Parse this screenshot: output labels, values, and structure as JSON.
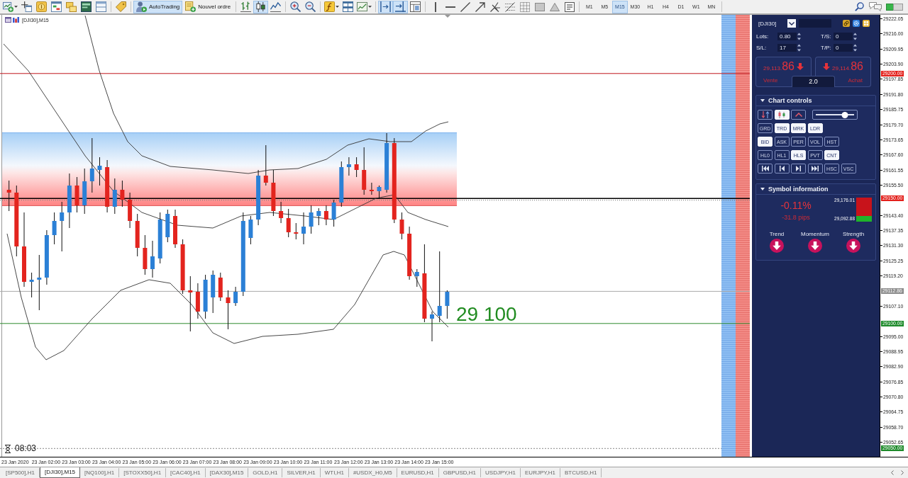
{
  "toolbar": {
    "buttons": [
      {
        "label": "AutoTrading",
        "pressed": true
      },
      {
        "label": "Nouvel ordre",
        "pressed": false
      }
    ],
    "chart_modes": [
      {
        "selected": false
      },
      {
        "selected": true
      },
      {
        "selected": false
      }
    ],
    "scroll_toggles": [
      {
        "on": true
      },
      {
        "on": true
      }
    ],
    "timeframes": [
      {
        "label": "M1",
        "selected": false
      },
      {
        "label": "M5",
        "selected": false
      },
      {
        "label": "M15",
        "selected": true
      },
      {
        "label": "M30",
        "selected": false
      },
      {
        "label": "H1",
        "selected": false
      },
      {
        "label": "H4",
        "selected": false
      },
      {
        "label": "D1",
        "selected": false
      },
      {
        "label": "W1",
        "selected": false
      },
      {
        "label": "MN",
        "selected": false
      }
    ]
  },
  "chart": {
    "title": "[DJI30],M15",
    "level_label": "29 100",
    "timer": "08:03"
  },
  "trade_panel": {
    "symbol": "[DJI30]",
    "fields": [
      {
        "label": "Lots:",
        "value": "0.80"
      },
      {
        "label": "T/S:",
        "value": "0"
      },
      {
        "label": "S/L:",
        "value": "17"
      },
      {
        "label": "T/P:",
        "value": "0"
      }
    ],
    "sell": {
      "price_head": "29,113.",
      "price_tail": "86",
      "label": "Vente"
    },
    "buy": {
      "price_head": "29,114.",
      "price_tail": "86",
      "label": "Achat"
    },
    "spread": "2.0"
  },
  "chart_controls": {
    "title": "Chart controls",
    "expanded": true,
    "tools": [
      {
        "kind": "toggle",
        "on": false
      },
      {
        "kind": "toggle",
        "on": true
      },
      {
        "kind": "toggle",
        "on": false
      },
      {
        "kind": "slider",
        "level": 0.77
      }
    ],
    "rows": [
      [
        {
          "kind": "text",
          "label": "GRD",
          "on": false
        },
        {
          "kind": "text",
          "label": "TRD",
          "on": true
        },
        {
          "kind": "text",
          "label": "MRK",
          "on": true
        },
        {
          "kind": "text",
          "label": "LDR",
          "on": true
        }
      ],
      [
        {
          "kind": "text",
          "label": "BID",
          "on": true
        },
        {
          "kind": "text",
          "label": "ASK",
          "on": false
        },
        {
          "kind": "text",
          "label": "PER",
          "on": false
        },
        {
          "kind": "text",
          "label": "VOL",
          "on": false
        },
        {
          "kind": "text",
          "label": "HST",
          "on": false
        }
      ],
      [
        {
          "kind": "text",
          "label": "HL0",
          "on": false
        },
        {
          "kind": "text",
          "label": "HL1",
          "on": false
        },
        {
          "kind": "text",
          "label": "HLS",
          "on": true
        },
        {
          "kind": "text",
          "label": "PVT",
          "on": false
        },
        {
          "kind": "text",
          "label": "CNT",
          "on": true
        }
      ],
      [
        {
          "kind": "nav"
        },
        {
          "kind": "nav"
        },
        {
          "kind": "nav"
        },
        {
          "kind": "nav"
        },
        {
          "kind": "text",
          "label": "HSC",
          "on": false
        },
        {
          "kind": "text",
          "label": "VSC",
          "on": false
        }
      ]
    ]
  },
  "symbol_info": {
    "title": "Symbol information",
    "expanded": true,
    "change": "-0.11%",
    "pips": "-31.8 pips",
    "high": "29,176.01",
    "low": "29,092.88",
    "indicators": [
      {
        "label": "Trend",
        "up": false
      },
      {
        "label": "Momentum",
        "up": false
      },
      {
        "label": "Strength",
        "up": false
      }
    ]
  },
  "price_axis": {
    "labels": [
      "29222.05",
      "29216.00",
      "29209.95",
      "29203.90",
      "29197.85",
      "29191.80",
      "29185.75",
      "29179.70",
      "29173.65",
      "29167.60",
      "29161.55",
      "29155.50",
      "29143.40",
      "29137.35",
      "29131.30",
      "29125.25",
      "29119.20",
      "29107.10",
      "29095.00",
      "29088.95",
      "29082.90",
      "29076.85",
      "29070.80",
      "29064.75",
      "29058.70",
      "29052.65"
    ],
    "markers": [
      {
        "text": "29200.00",
        "color": "#e3201b"
      },
      {
        "text": "29150.00",
        "color": "#e3201b"
      },
      {
        "text": "29112.86",
        "color": "#8c8c8c"
      },
      {
        "text": "29100.00",
        "color": "#1d8a2a"
      },
      {
        "text": "29050.00",
        "color": "#1d8a2a"
      }
    ]
  },
  "time_axis": {
    "labels": [
      "23 Jan 2020",
      "23 Jan 02:00",
      "23 Jan 03:00",
      "23 Jan 04:00",
      "23 Jan 05:00",
      "23 Jan 06:00",
      "23 Jan 07:00",
      "23 Jan 08:00",
      "23 Jan 09:00",
      "23 Jan 10:00",
      "23 Jan 11:00",
      "23 Jan 12:00",
      "23 Jan 13:00",
      "23 Jan 14:00",
      "23 Jan 15:00"
    ]
  },
  "tabs": [
    {
      "label": "[SP500],H1",
      "selected": false
    },
    {
      "label": "[DJI30],M15",
      "selected": true
    },
    {
      "label": "[NQ100],H1",
      "selected": false
    },
    {
      "label": "[STOXX50],H1",
      "selected": false
    },
    {
      "label": "[CAC40],H1",
      "selected": false
    },
    {
      "label": "[DAX30],M15",
      "selected": false
    },
    {
      "label": "GOLD,H1",
      "selected": false
    },
    {
      "label": "SILVER,H1",
      "selected": false
    },
    {
      "label": "WTI,H1",
      "selected": false
    },
    {
      "label": "#USDX_H0,M5",
      "selected": false
    },
    {
      "label": "EURUSD,H1",
      "selected": false
    },
    {
      "label": "GBPUSD,H1",
      "selected": false
    },
    {
      "label": "USDJPY,H1",
      "selected": false
    },
    {
      "label": "EURJPY,H1",
      "selected": false
    },
    {
      "label": "BTCUSD,H1",
      "selected": false
    }
  ]
}
